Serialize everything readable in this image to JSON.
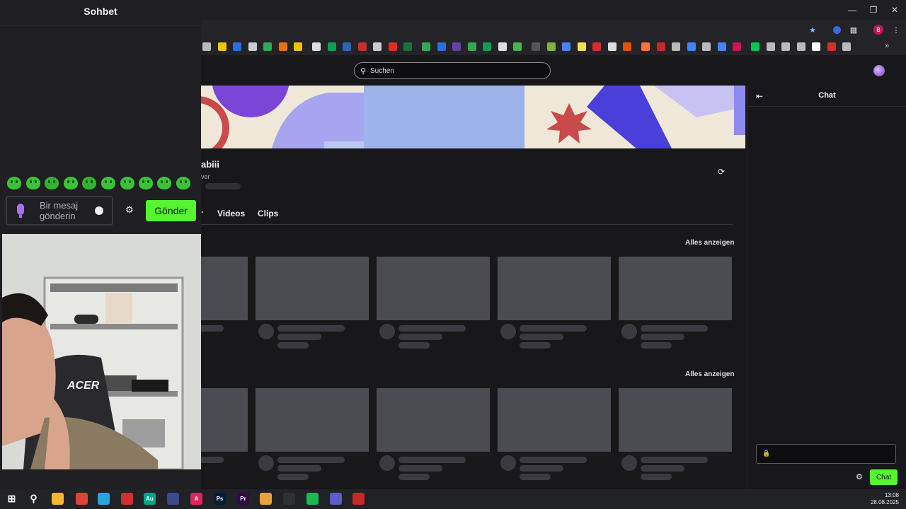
{
  "overlay": {
    "title": "Sohbet",
    "message_placeholder": "Bir mesaj gönderin",
    "send_label": "Gönder"
  },
  "browser": {
    "profile_initial": "B"
  },
  "header": {
    "search_placeholder": "Suchen"
  },
  "channel": {
    "name_partial": "abiii",
    "subtitle_partial": "ver"
  },
  "tabs": [
    {
      "label": "Videos"
    },
    {
      "label": "Clips"
    }
  ],
  "sections": [
    {
      "show_all": "Alles anzeigen"
    },
    {
      "show_all": "Alles anzeigen"
    }
  ],
  "chat": {
    "title": "Chat",
    "send_label": "Chat"
  },
  "webcam": {
    "chair_brand": "ACER"
  },
  "taskbar": {
    "time": "13:08",
    "date": "28.08.2025"
  },
  "colors": {
    "accent_green": "#55f530",
    "accent_purple": "#a970ff",
    "background": "#18181b"
  }
}
